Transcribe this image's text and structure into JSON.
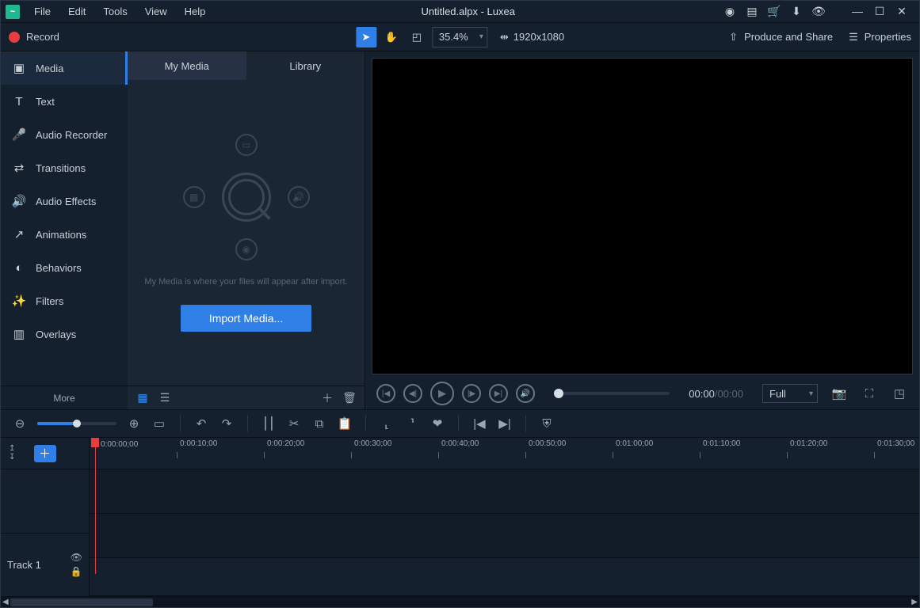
{
  "title": "Untitled.alpx - Luxea",
  "menubar": {
    "file": "File",
    "edit": "Edit",
    "tools": "Tools",
    "view": "View",
    "help": "Help"
  },
  "toolbar": {
    "record": "Record",
    "zoom": "35.4%",
    "dimensions": "1920x1080",
    "produce": "Produce and Share",
    "properties": "Properties"
  },
  "sidebar": {
    "items": [
      {
        "label": "Media"
      },
      {
        "label": "Text"
      },
      {
        "label": "Audio Recorder"
      },
      {
        "label": "Transitions"
      },
      {
        "label": "Audio Effects"
      },
      {
        "label": "Animations"
      },
      {
        "label": "Behaviors"
      },
      {
        "label": "Filters"
      },
      {
        "label": "Overlays"
      }
    ],
    "more": "More"
  },
  "media": {
    "tabs": {
      "mymedia": "My Media",
      "library": "Library"
    },
    "hint": "My Media is where your files will appear after import.",
    "import_btn": "Import Media..."
  },
  "playback": {
    "current": "00:00",
    "total": "00:00",
    "quality": "Full"
  },
  "timeline": {
    "playhead_label": "0:00:00;00",
    "marks": [
      "0:00:10;00",
      "0:00:20;00",
      "0:00:30;00",
      "0:00:40;00",
      "0:00:50;00",
      "0:01:00;00",
      "0:01:10;00",
      "0:01:20;00",
      "0:01:30;00"
    ],
    "track1": "Track 1"
  }
}
